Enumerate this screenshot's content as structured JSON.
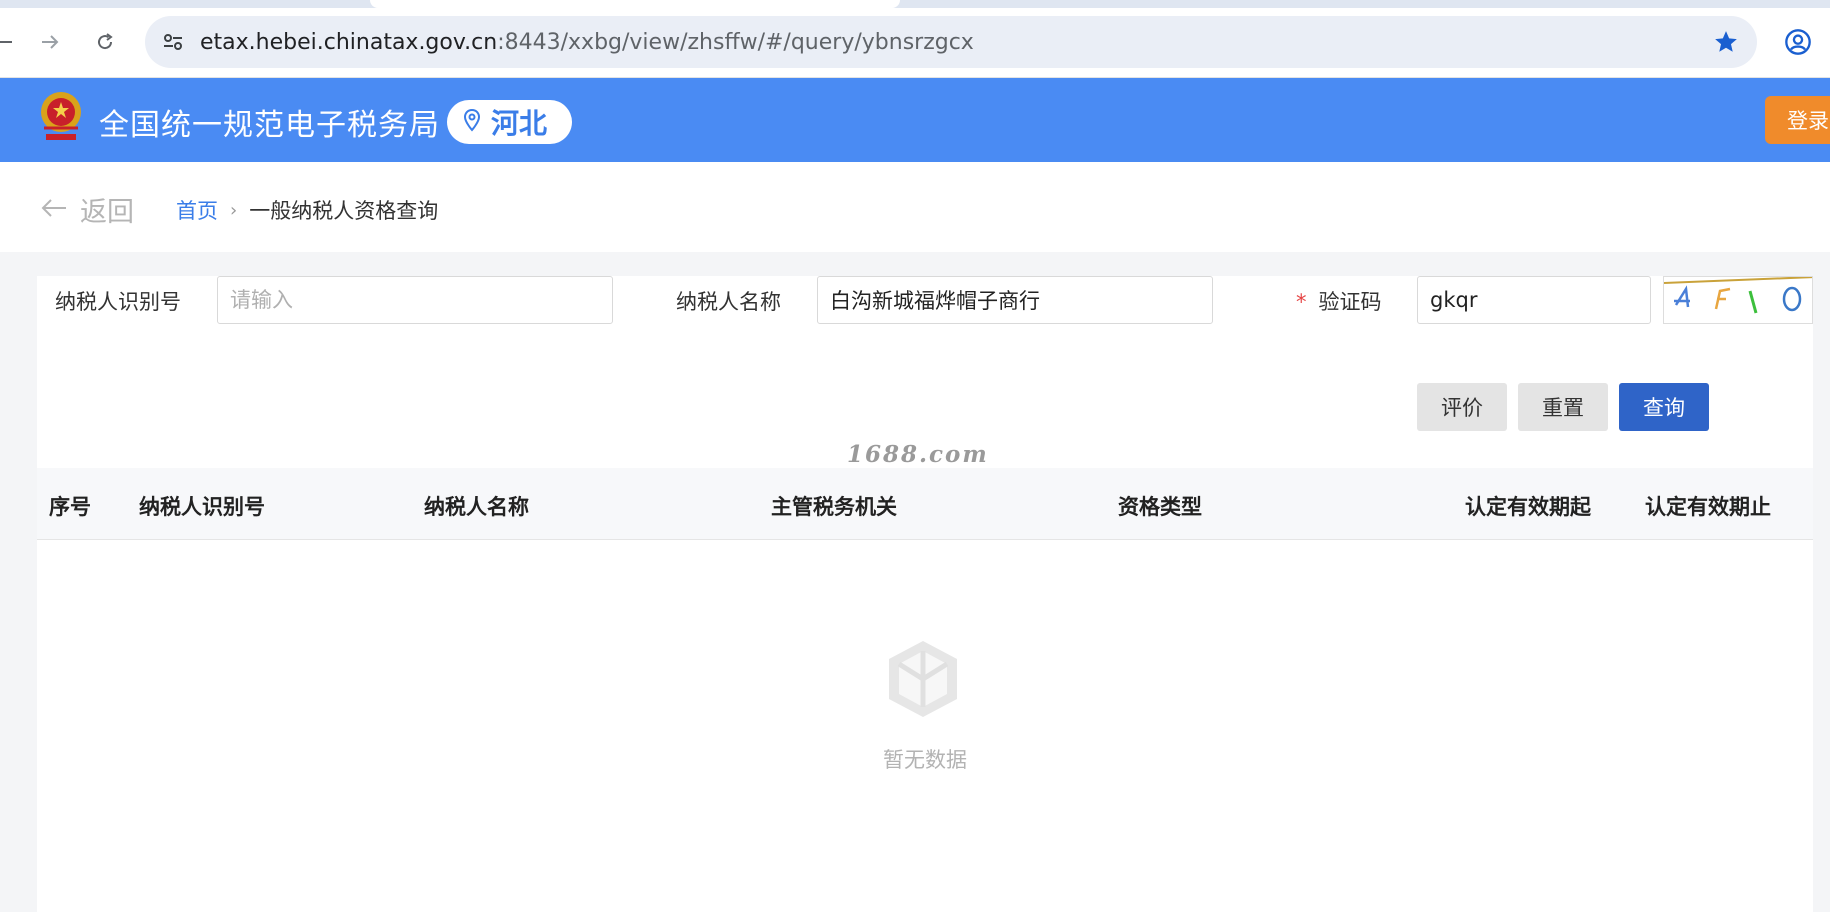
{
  "browser": {
    "url_host": "etax.hebei.chinatax.gov.cn",
    "url_rest": ":8443/xxbg/view/zhsffw/#/query/ybnsrzgcx"
  },
  "header": {
    "site_title": "全国统一规范电子税务局",
    "region": "河北",
    "login": "登录",
    "brand_color": "#4a8bf3"
  },
  "breadcrumb": {
    "back": "返回",
    "home": "首页",
    "current": "一般纳税人资格查询"
  },
  "form": {
    "taxpayer_id_label": "纳税人识别号",
    "taxpayer_id_placeholder": "请输入",
    "taxpayer_id_value": "",
    "taxpayer_name_label": "纳税人名称",
    "taxpayer_name_value": "白沟新城福烨帽子商行",
    "captcha_label": "验证码",
    "captcha_required_mark": "*",
    "captcha_value": "gkqr"
  },
  "buttons": {
    "evaluate": "评价",
    "reset": "重置",
    "query": "查询"
  },
  "watermark": "1688.com",
  "table": {
    "columns": [
      "序号",
      "纳税人识别号",
      "纳税人名称",
      "主管税务机关",
      "资格类型",
      "认定有效期起",
      "认定有效期止"
    ],
    "rows": [],
    "empty_text": "暂无数据"
  }
}
